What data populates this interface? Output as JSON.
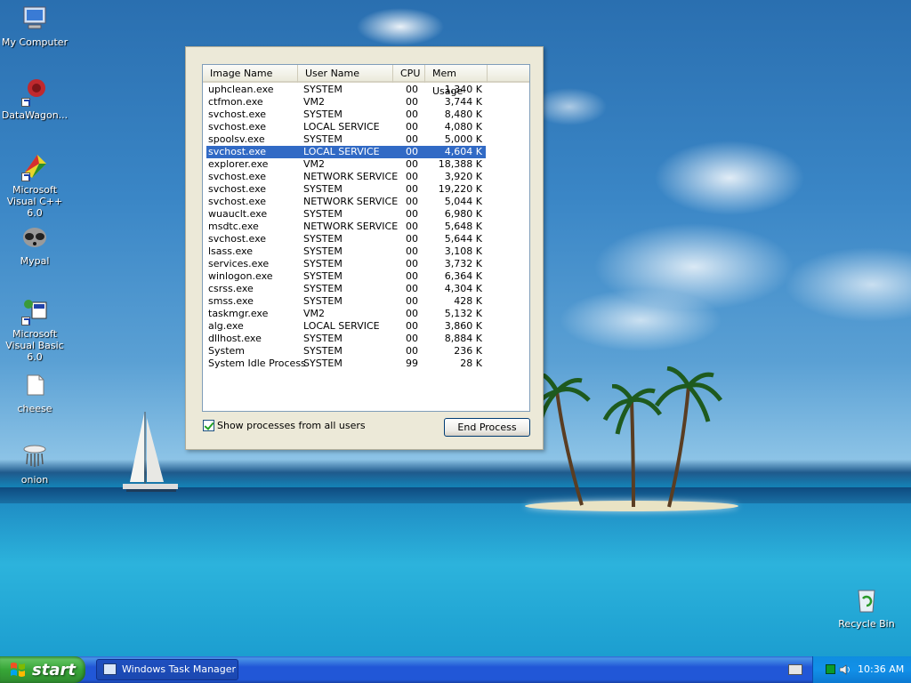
{
  "desktop": {
    "icons": [
      {
        "label": "My Computer",
        "icon": "my-computer-icon"
      },
      {
        "label": "DataWagon...",
        "icon": "datawagon-icon"
      },
      {
        "label": "Microsoft Visual C++ 6.0",
        "icon": "visual-cpp-icon"
      },
      {
        "label": "Mypal",
        "icon": "mypal-raccoon-icon"
      },
      {
        "label": "Microsoft Visual Basic 6.0",
        "icon": "visual-basic-icon"
      },
      {
        "label": "cheese",
        "icon": "folder-icon"
      },
      {
        "label": "onion",
        "icon": "onion-icon"
      },
      {
        "label": "Recycle Bin",
        "icon": "recycle-bin-icon"
      }
    ]
  },
  "task_manager": {
    "columns": {
      "image_name": "Image Name",
      "user_name": "User Name",
      "cpu": "CPU",
      "mem_usage": "Mem Usage"
    },
    "selected_row": 5,
    "processes": [
      {
        "name": "uphclean.exe",
        "user": "SYSTEM",
        "cpu": "00",
        "mem": "1,340 K"
      },
      {
        "name": "ctfmon.exe",
        "user": "VM2",
        "cpu": "00",
        "mem": "3,744 K"
      },
      {
        "name": "svchost.exe",
        "user": "SYSTEM",
        "cpu": "00",
        "mem": "8,480 K"
      },
      {
        "name": "svchost.exe",
        "user": "LOCAL SERVICE",
        "cpu": "00",
        "mem": "4,080 K"
      },
      {
        "name": "spoolsv.exe",
        "user": "SYSTEM",
        "cpu": "00",
        "mem": "5,000 K"
      },
      {
        "name": "svchost.exe",
        "user": "LOCAL SERVICE",
        "cpu": "00",
        "mem": "4,604 K"
      },
      {
        "name": "explorer.exe",
        "user": "VM2",
        "cpu": "00",
        "mem": "18,388 K"
      },
      {
        "name": "svchost.exe",
        "user": "NETWORK SERVICE",
        "cpu": "00",
        "mem": "3,920 K"
      },
      {
        "name": "svchost.exe",
        "user": "SYSTEM",
        "cpu": "00",
        "mem": "19,220 K"
      },
      {
        "name": "svchost.exe",
        "user": "NETWORK SERVICE",
        "cpu": "00",
        "mem": "5,044 K"
      },
      {
        "name": "wuauclt.exe",
        "user": "SYSTEM",
        "cpu": "00",
        "mem": "6,980 K"
      },
      {
        "name": "msdtc.exe",
        "user": "NETWORK SERVICE",
        "cpu": "00",
        "mem": "5,648 K"
      },
      {
        "name": "svchost.exe",
        "user": "SYSTEM",
        "cpu": "00",
        "mem": "5,644 K"
      },
      {
        "name": "lsass.exe",
        "user": "SYSTEM",
        "cpu": "00",
        "mem": "3,108 K"
      },
      {
        "name": "services.exe",
        "user": "SYSTEM",
        "cpu": "00",
        "mem": "3,732 K"
      },
      {
        "name": "winlogon.exe",
        "user": "SYSTEM",
        "cpu": "00",
        "mem": "6,364 K"
      },
      {
        "name": "csrss.exe",
        "user": "SYSTEM",
        "cpu": "00",
        "mem": "4,304 K"
      },
      {
        "name": "smss.exe",
        "user": "SYSTEM",
        "cpu": "00",
        "mem": "428 K"
      },
      {
        "name": "taskmgr.exe",
        "user": "VM2",
        "cpu": "00",
        "mem": "5,132 K"
      },
      {
        "name": "alg.exe",
        "user": "LOCAL SERVICE",
        "cpu": "00",
        "mem": "3,860 K"
      },
      {
        "name": "dllhost.exe",
        "user": "SYSTEM",
        "cpu": "00",
        "mem": "8,884 K"
      },
      {
        "name": "System",
        "user": "SYSTEM",
        "cpu": "00",
        "mem": "236 K"
      },
      {
        "name": "System Idle Process",
        "user": "SYSTEM",
        "cpu": "99",
        "mem": "28 K"
      }
    ],
    "show_all_label": "Show processes from all users",
    "show_all_checked": true,
    "end_process_label": "End Process"
  },
  "taskbar": {
    "start_label": "start",
    "task_button_label": "Windows Task Manager",
    "clock": "10:36 AM",
    "colors": {
      "start_green": "#37a637",
      "bar_blue": "#2157d7",
      "tray_blue": "#1290e8"
    }
  }
}
